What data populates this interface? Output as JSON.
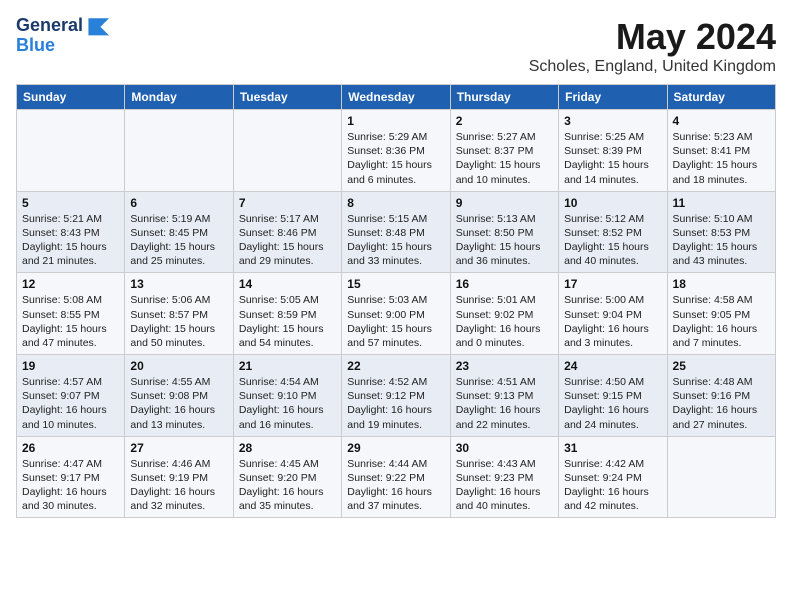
{
  "header": {
    "logo_line1": "General",
    "logo_line2": "Blue",
    "month_year": "May 2024",
    "location": "Scholes, England, United Kingdom"
  },
  "weekdays": [
    "Sunday",
    "Monday",
    "Tuesday",
    "Wednesday",
    "Thursday",
    "Friday",
    "Saturday"
  ],
  "weeks": [
    [
      {
        "day": "",
        "info": ""
      },
      {
        "day": "",
        "info": ""
      },
      {
        "day": "",
        "info": ""
      },
      {
        "day": "1",
        "info": "Sunrise: 5:29 AM\nSunset: 8:36 PM\nDaylight: 15 hours\nand 6 minutes."
      },
      {
        "day": "2",
        "info": "Sunrise: 5:27 AM\nSunset: 8:37 PM\nDaylight: 15 hours\nand 10 minutes."
      },
      {
        "day": "3",
        "info": "Sunrise: 5:25 AM\nSunset: 8:39 PM\nDaylight: 15 hours\nand 14 minutes."
      },
      {
        "day": "4",
        "info": "Sunrise: 5:23 AM\nSunset: 8:41 PM\nDaylight: 15 hours\nand 18 minutes."
      }
    ],
    [
      {
        "day": "5",
        "info": "Sunrise: 5:21 AM\nSunset: 8:43 PM\nDaylight: 15 hours\nand 21 minutes."
      },
      {
        "day": "6",
        "info": "Sunrise: 5:19 AM\nSunset: 8:45 PM\nDaylight: 15 hours\nand 25 minutes."
      },
      {
        "day": "7",
        "info": "Sunrise: 5:17 AM\nSunset: 8:46 PM\nDaylight: 15 hours\nand 29 minutes."
      },
      {
        "day": "8",
        "info": "Sunrise: 5:15 AM\nSunset: 8:48 PM\nDaylight: 15 hours\nand 33 minutes."
      },
      {
        "day": "9",
        "info": "Sunrise: 5:13 AM\nSunset: 8:50 PM\nDaylight: 15 hours\nand 36 minutes."
      },
      {
        "day": "10",
        "info": "Sunrise: 5:12 AM\nSunset: 8:52 PM\nDaylight: 15 hours\nand 40 minutes."
      },
      {
        "day": "11",
        "info": "Sunrise: 5:10 AM\nSunset: 8:53 PM\nDaylight: 15 hours\nand 43 minutes."
      }
    ],
    [
      {
        "day": "12",
        "info": "Sunrise: 5:08 AM\nSunset: 8:55 PM\nDaylight: 15 hours\nand 47 minutes."
      },
      {
        "day": "13",
        "info": "Sunrise: 5:06 AM\nSunset: 8:57 PM\nDaylight: 15 hours\nand 50 minutes."
      },
      {
        "day": "14",
        "info": "Sunrise: 5:05 AM\nSunset: 8:59 PM\nDaylight: 15 hours\nand 54 minutes."
      },
      {
        "day": "15",
        "info": "Sunrise: 5:03 AM\nSunset: 9:00 PM\nDaylight: 15 hours\nand 57 minutes."
      },
      {
        "day": "16",
        "info": "Sunrise: 5:01 AM\nSunset: 9:02 PM\nDaylight: 16 hours\nand 0 minutes."
      },
      {
        "day": "17",
        "info": "Sunrise: 5:00 AM\nSunset: 9:04 PM\nDaylight: 16 hours\nand 3 minutes."
      },
      {
        "day": "18",
        "info": "Sunrise: 4:58 AM\nSunset: 9:05 PM\nDaylight: 16 hours\nand 7 minutes."
      }
    ],
    [
      {
        "day": "19",
        "info": "Sunrise: 4:57 AM\nSunset: 9:07 PM\nDaylight: 16 hours\nand 10 minutes."
      },
      {
        "day": "20",
        "info": "Sunrise: 4:55 AM\nSunset: 9:08 PM\nDaylight: 16 hours\nand 13 minutes."
      },
      {
        "day": "21",
        "info": "Sunrise: 4:54 AM\nSunset: 9:10 PM\nDaylight: 16 hours\nand 16 minutes."
      },
      {
        "day": "22",
        "info": "Sunrise: 4:52 AM\nSunset: 9:12 PM\nDaylight: 16 hours\nand 19 minutes."
      },
      {
        "day": "23",
        "info": "Sunrise: 4:51 AM\nSunset: 9:13 PM\nDaylight: 16 hours\nand 22 minutes."
      },
      {
        "day": "24",
        "info": "Sunrise: 4:50 AM\nSunset: 9:15 PM\nDaylight: 16 hours\nand 24 minutes."
      },
      {
        "day": "25",
        "info": "Sunrise: 4:48 AM\nSunset: 9:16 PM\nDaylight: 16 hours\nand 27 minutes."
      }
    ],
    [
      {
        "day": "26",
        "info": "Sunrise: 4:47 AM\nSunset: 9:17 PM\nDaylight: 16 hours\nand 30 minutes."
      },
      {
        "day": "27",
        "info": "Sunrise: 4:46 AM\nSunset: 9:19 PM\nDaylight: 16 hours\nand 32 minutes."
      },
      {
        "day": "28",
        "info": "Sunrise: 4:45 AM\nSunset: 9:20 PM\nDaylight: 16 hours\nand 35 minutes."
      },
      {
        "day": "29",
        "info": "Sunrise: 4:44 AM\nSunset: 9:22 PM\nDaylight: 16 hours\nand 37 minutes."
      },
      {
        "day": "30",
        "info": "Sunrise: 4:43 AM\nSunset: 9:23 PM\nDaylight: 16 hours\nand 40 minutes."
      },
      {
        "day": "31",
        "info": "Sunrise: 4:42 AM\nSunset: 9:24 PM\nDaylight: 16 hours\nand 42 minutes."
      },
      {
        "day": "",
        "info": ""
      }
    ]
  ]
}
